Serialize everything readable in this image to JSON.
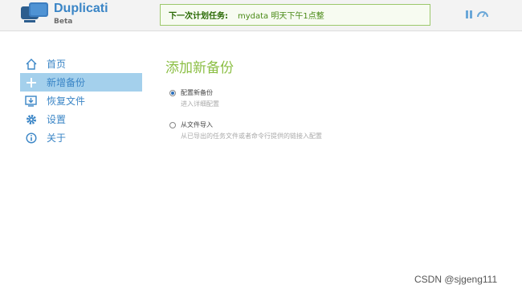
{
  "header": {
    "brand_name": "Duplicati",
    "brand_sub": "Beta",
    "schedule_label": "下一次计划任务:",
    "schedule_value": "mydata 明天下午1点整"
  },
  "sidebar": {
    "items": [
      {
        "label": "首页",
        "icon": "home-icon"
      },
      {
        "label": "新增备份",
        "icon": "plus-icon"
      },
      {
        "label": "恢复文件",
        "icon": "restore-icon"
      },
      {
        "label": "设置",
        "icon": "gear-icon"
      },
      {
        "label": "关于",
        "icon": "info-icon"
      }
    ]
  },
  "main": {
    "title": "添加新备份",
    "options": [
      {
        "label": "配置新备份",
        "description": "进入详细配置",
        "selected": true
      },
      {
        "label": "从文件导入",
        "description": "从已导出的任务文件或者命令行提供的链接入配置",
        "selected": false
      }
    ]
  },
  "watermark": "CSDN @sjgeng111",
  "colors": {
    "brand": "#3a85c6",
    "accent_green": "#8cbf45",
    "active_bg": "#a4d0ec"
  }
}
